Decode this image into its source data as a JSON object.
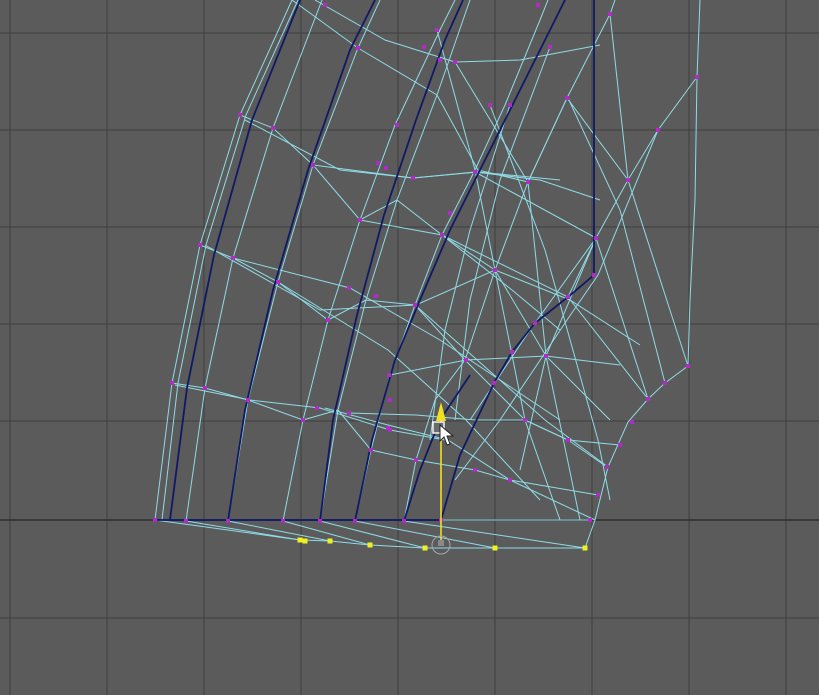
{
  "viewport": {
    "view": "3d-viewport",
    "background_color": "#5b5b5b",
    "grid_color": "#3f3f3f",
    "world_axis_color": "#2e2e2e"
  },
  "colors": {
    "wire": "#8fdbe6",
    "edge_selected": "#0f1a66",
    "vertex": "#b02cc8",
    "vertex_selected": "#f0f020",
    "gizmo_axis": "#f0e020"
  },
  "gizmo": {
    "name": "move-gizmo-y-axis",
    "icon": "arrow-up-icon"
  },
  "cursor": {
    "icon": "mouse-pointer-icon"
  }
}
